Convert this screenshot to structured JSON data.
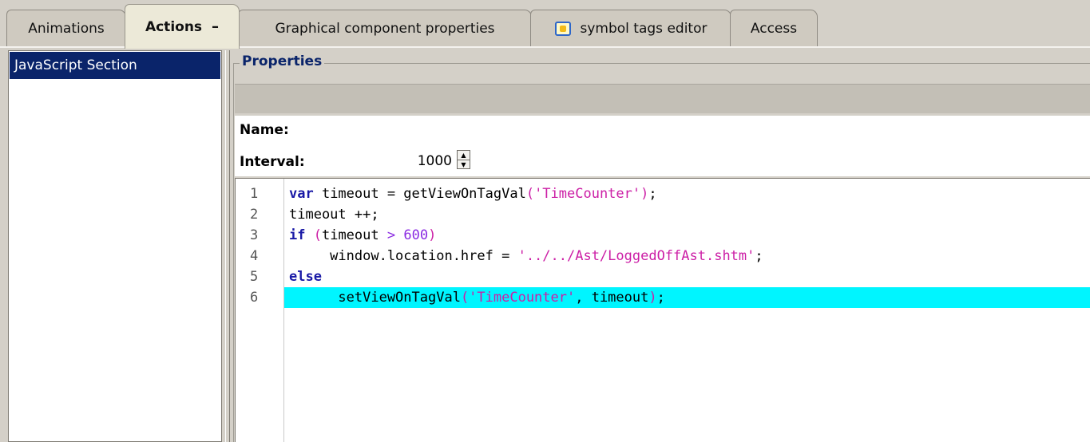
{
  "tabs": [
    {
      "label": "Animations",
      "active": false
    },
    {
      "label": "Actions",
      "active": true,
      "close": "–"
    },
    {
      "label": "Graphical component properties",
      "active": false
    },
    {
      "label": "symbol tags editor",
      "active": false,
      "icon": "tag-icon"
    },
    {
      "label": "Access",
      "active": false
    }
  ],
  "left_list": {
    "items": [
      {
        "label": "JavaScript Section",
        "selected": true
      }
    ]
  },
  "properties": {
    "title": "Properties",
    "name_label": "Name:",
    "name_value": "",
    "interval_label": "Interval:",
    "interval_value": "1000"
  },
  "code": {
    "line_numbers": [
      "1",
      "2",
      "3",
      "4",
      "5",
      "6"
    ],
    "highlighted_line": 6,
    "lines": [
      {
        "tokens": [
          {
            "t": "var",
            "c": "kw"
          },
          {
            "t": " timeout = getViewOnTagVal",
            "c": "plain"
          },
          {
            "t": "('TimeCounter')",
            "c": "str"
          },
          {
            "t": ";",
            "c": "plain"
          }
        ]
      },
      {
        "tokens": [
          {
            "t": "timeout ++;",
            "c": "plain"
          }
        ]
      },
      {
        "tokens": [
          {
            "t": "if",
            "c": "kw"
          },
          {
            "t": " (",
            "c": "paren"
          },
          {
            "t": "timeout ",
            "c": "plain"
          },
          {
            "t": ">",
            "c": "op"
          },
          {
            "t": " 600",
            "c": "num"
          },
          {
            "t": ")",
            "c": "paren"
          }
        ]
      },
      {
        "tokens": [
          {
            "t": "     window.location.href = ",
            "c": "plain"
          },
          {
            "t": "'../../Ast/LoggedOffAst.shtm'",
            "c": "str"
          },
          {
            "t": ";",
            "c": "plain"
          }
        ]
      },
      {
        "tokens": [
          {
            "t": "else",
            "c": "kw"
          }
        ]
      },
      {
        "tokens": [
          {
            "t": "      setViewOnTagVal",
            "c": "plain"
          },
          {
            "t": "('TimeCounter'",
            "c": "str"
          },
          {
            "t": ", timeout",
            "c": "plain"
          },
          {
            "t": ")",
            "c": "paren"
          },
          {
            "t": ";",
            "c": "plain"
          }
        ]
      }
    ]
  },
  "colors": {
    "selection": "#0a246a",
    "line_highlight": "#00f5ff",
    "keyword": "#1a1aa6",
    "string": "#cc1fa6"
  }
}
